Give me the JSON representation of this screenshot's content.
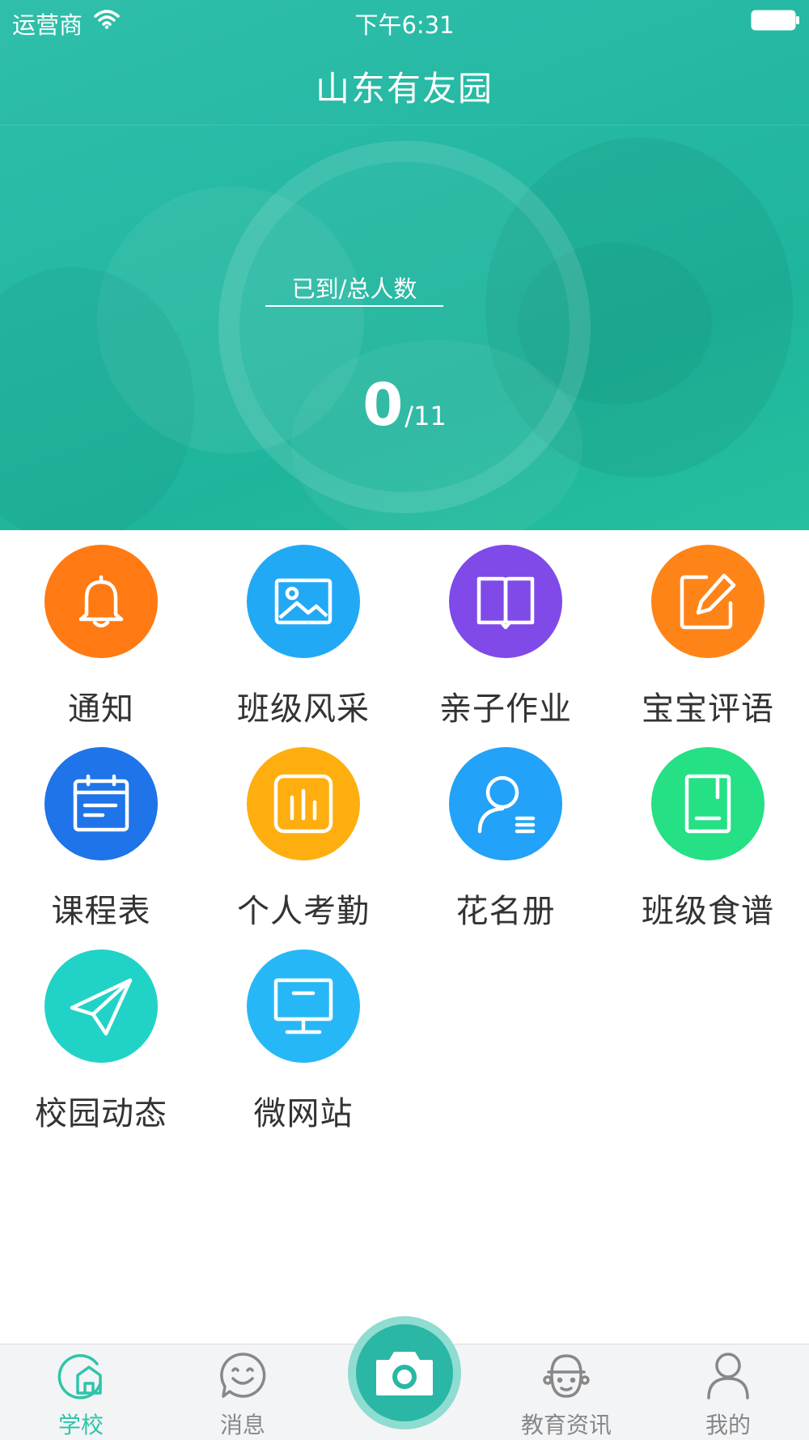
{
  "status_bar": {
    "carrier": "运营商",
    "time": "下午6:31"
  },
  "header": {
    "title": "山东有友园"
  },
  "attendance": {
    "label": "已到/总人数",
    "arrived": "0",
    "total": "/11"
  },
  "menu": [
    {
      "label": "通知",
      "icon": "bell-icon",
      "color": "#ff7a12"
    },
    {
      "label": "班级风采",
      "icon": "image-icon",
      "color": "#22a9f5"
    },
    {
      "label": "亲子作业",
      "icon": "book-icon",
      "color": "#7f4ae8"
    },
    {
      "label": "宝宝评语",
      "icon": "edit-icon",
      "color": "#ff8418"
    },
    {
      "label": "课程表",
      "icon": "calendar-icon",
      "color": "#1e74e8"
    },
    {
      "label": "个人考勤",
      "icon": "bar-chart-icon",
      "color": "#ffae0f"
    },
    {
      "label": "花名册",
      "icon": "person-list-icon",
      "color": "#22a2f8"
    },
    {
      "label": "班级食谱",
      "icon": "recipe-book-icon",
      "color": "#25e084"
    },
    {
      "label": "校园动态",
      "icon": "paper-plane-icon",
      "color": "#20d3c6"
    },
    {
      "label": "微网站",
      "icon": "monitor-icon",
      "color": "#26b8f6"
    }
  ],
  "tabbar": {
    "tabs": [
      {
        "label": "学校",
        "icon": "school-home-icon",
        "active": true
      },
      {
        "label": "消息",
        "icon": "smile-chat-icon",
        "active": false
      },
      {
        "label": "",
        "icon": "camera-icon",
        "active": false
      },
      {
        "label": "教育资讯",
        "icon": "kid-face-icon",
        "active": false
      },
      {
        "label": "我的",
        "icon": "person-icon",
        "active": false
      }
    ]
  },
  "colors": {
    "accent": "#2fc4aa",
    "header": "#26b9a4",
    "camera": "#2ab7a5"
  }
}
